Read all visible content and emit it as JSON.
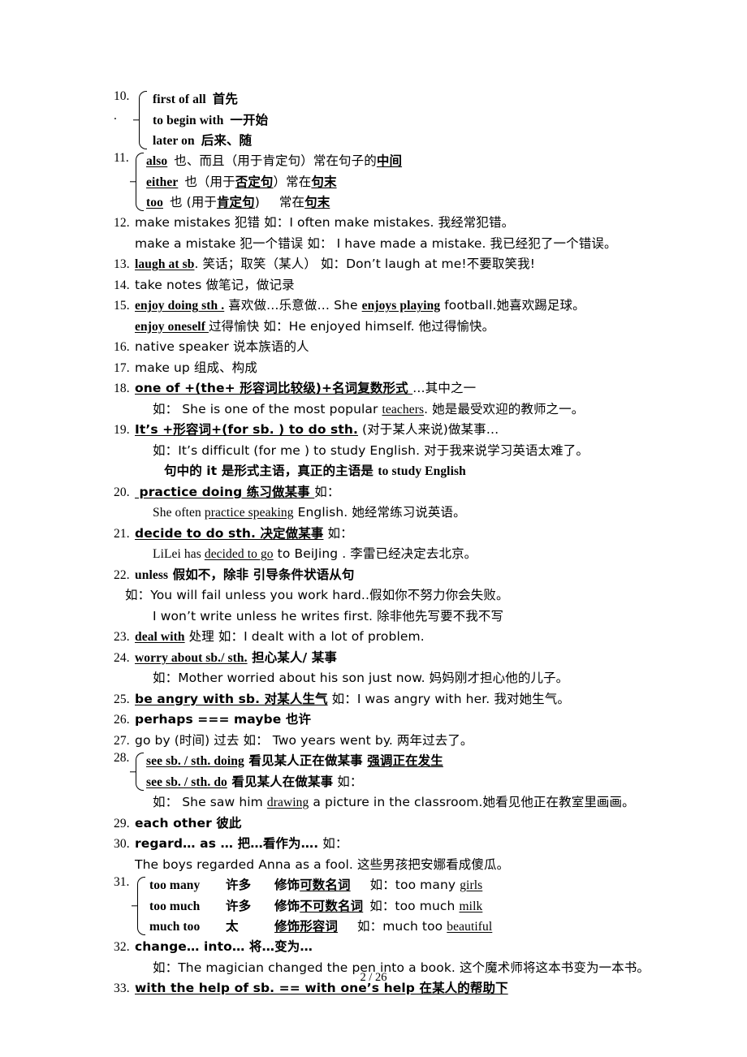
{
  "document": {
    "page_label": "2  / 26",
    "entries": [
      {
        "number": "10.",
        "sub_marker": ".",
        "type": "brace",
        "items": [
          {
            "term": "first of all",
            "meaning": "首先"
          },
          {
            "term": "to begin with",
            "meaning": "一开始"
          },
          {
            "term": "later on",
            "meaning": "后来、随"
          }
        ]
      },
      {
        "number": "11.",
        "type": "brace",
        "items": [
          {
            "term": "also",
            "meaning": "也、而且（用于肯定句）常在句子的",
            "tail": "中间"
          },
          {
            "term": "either",
            "meaning": "也（用于",
            "mid": "否定句",
            "meaning2": "）常在",
            "tail": "句末"
          },
          {
            "term": "too",
            "meaning": "也 (用于",
            "mid": "肯定句",
            "meaning2": ")",
            "meaning3": "常在",
            "tail": "句末"
          }
        ]
      },
      {
        "number": "12.",
        "type": "plain",
        "line1": "make mistakes  犯错  如：I often make mistakes.  我经常犯错。",
        "line2": "make a mistake  犯一个错误  如：   I have made a mistake.  我已经犯了一个错误。"
      },
      {
        "number": "13.",
        "type": "plain",
        "term": "laugh at sb",
        "rest": ".  笑话；取笑（某人）   如：Don’t laugh at me!不要取笑我!"
      },
      {
        "number": "14.",
        "type": "plain",
        "line1": "take notes  做笔记，做记录"
      },
      {
        "number": "15.",
        "type": "plain",
        "term": "enjoy doing sth .",
        "rest1": "  喜欢做…乐意做…  She ",
        "term2": "enjoys playing",
        "rest2": " football.她喜欢踢足球。",
        "term3": "enjoy oneself ",
        "rest3": "  过得愉快  如：He enjoyed himself.  他过得愉快。"
      },
      {
        "number": "16.",
        "type": "plain",
        "line1": "native speaker  说本族语的人"
      },
      {
        "number": "17.",
        "type": "plain",
        "line1": "make up  组成、构成"
      },
      {
        "number": "18.",
        "type": "plain",
        "term": "one of +(the+  形容词比较级)+名词复数形式 ",
        "rest": "  …其中之一",
        "example_prefix": "如：   She is one of the most popular ",
        "example_underline": "teachers",
        "example_suffix": ".  她是最受欢迎的教师之一。"
      },
      {
        "number": "19.",
        "type": "plain",
        "term": "It’s +形容词+(for sb. ) to do sth.",
        "rest": " (对于某人来说)做某事…",
        "example": "如：It’s difficult (for me ) to study English.    对于我来说学习英语太难了。",
        "note_prefix": "句中的 it  是形式主语，真正的主语是 ",
        "note_bold": "to study English"
      },
      {
        "number": "20.",
        "type": "plain",
        "term": " practice doing  练习做某事  ",
        "rest": "   如：",
        "example_prefix": "She often ",
        "example_underline": "practice speaking",
        "example_suffix": " English.  她经常练习说英语。"
      },
      {
        "number": "21.",
        "type": "plain",
        "term": "decide to do sth.  决定做某事",
        "rest": "  如：",
        "example_prefix": "LiLei has ",
        "example_underline": "decided to go",
        "example_suffix": " to BeiJing .  李雷已经决定去北京。"
      },
      {
        "number": "22.",
        "type": "plain",
        "term": "unless",
        "rest": "  假如不，除非  引导条件状语从句",
        "example1": "如：You will fail unless you work hard..假如你不努力你会失败。",
        "example2": "I won’t write unless he writes first.  除非他先写要不我不写"
      },
      {
        "number": "23.",
        "type": "plain",
        "term": "deal with",
        "rest": "  处理  如：I dealt with a lot of problem."
      },
      {
        "number": "24.",
        "type": "plain",
        "term": "worry about sb./ sth.",
        "rest": "  担心某人/ 某事",
        "example": "如：Mother worried about his son just now.  妈妈刚才担心他的儿子。"
      },
      {
        "number": "25.",
        "type": "plain",
        "term": "be angry with sb.  对某人生气",
        "rest": "  如：I was angry with her.  我对她生气。"
      },
      {
        "number": "26.",
        "type": "plain",
        "term": "perhaps === maybe  也许"
      },
      {
        "number": "27.",
        "type": "plain",
        "line1": "go by (时间)  过去  如：   Two years went by.  两年过去了。"
      },
      {
        "number": "28.",
        "type": "brace",
        "items": [
          {
            "term": "see sb. / sth. doing",
            "meaning": " 看见某人正在做某事 ",
            "tail": "强调正在发生"
          },
          {
            "term": "see sb. / sth. do",
            "meaning": "      看见某人在做某事",
            "tail2": "  如："
          }
        ],
        "example_prefix": "如：   She saw him ",
        "example_underline": "drawing",
        "example_suffix": " a picture in the classroom.她看见他正在教室里画画。"
      },
      {
        "number": "29.",
        "type": "plain",
        "term": "each other  彼此"
      },
      {
        "number": "30.",
        "type": "plain",
        "term": "regard… as …  把…看作为….",
        "rest": "   如：",
        "example": "The boys regarded Anna as a fool.  这些男孩把安娜看成傻瓜。"
      },
      {
        "number": "31.",
        "type": "brace",
        "items": [
          {
            "term": "too many",
            "col2": "许多",
            "col3_prefix": "修饰",
            "col3_underline": "可数名词",
            "col4": "如：too many ",
            "col4_underline": "girls"
          },
          {
            "term": "too much",
            "col2": "许多",
            "col3_prefix": "修饰",
            "col3_underline": "不可数名词",
            "col4": "如：too much ",
            "col4_underline": "milk"
          },
          {
            "term": "much too",
            "col2": "太",
            "col3_prefix": "",
            "col3_underline": "修饰形容词",
            "col4": "如：much too ",
            "col4_underline": "beautiful"
          }
        ]
      },
      {
        "number": "32.",
        "type": "plain",
        "term": "change…   into…   将…变为…",
        "example": "如：The magician changed the pen into a book.  这个魔术师将这本书变为一本书。"
      },
      {
        "number": "33.",
        "type": "plain",
        "term": "with the help of sb. == with one’s help  在某人的帮助下"
      }
    ]
  }
}
